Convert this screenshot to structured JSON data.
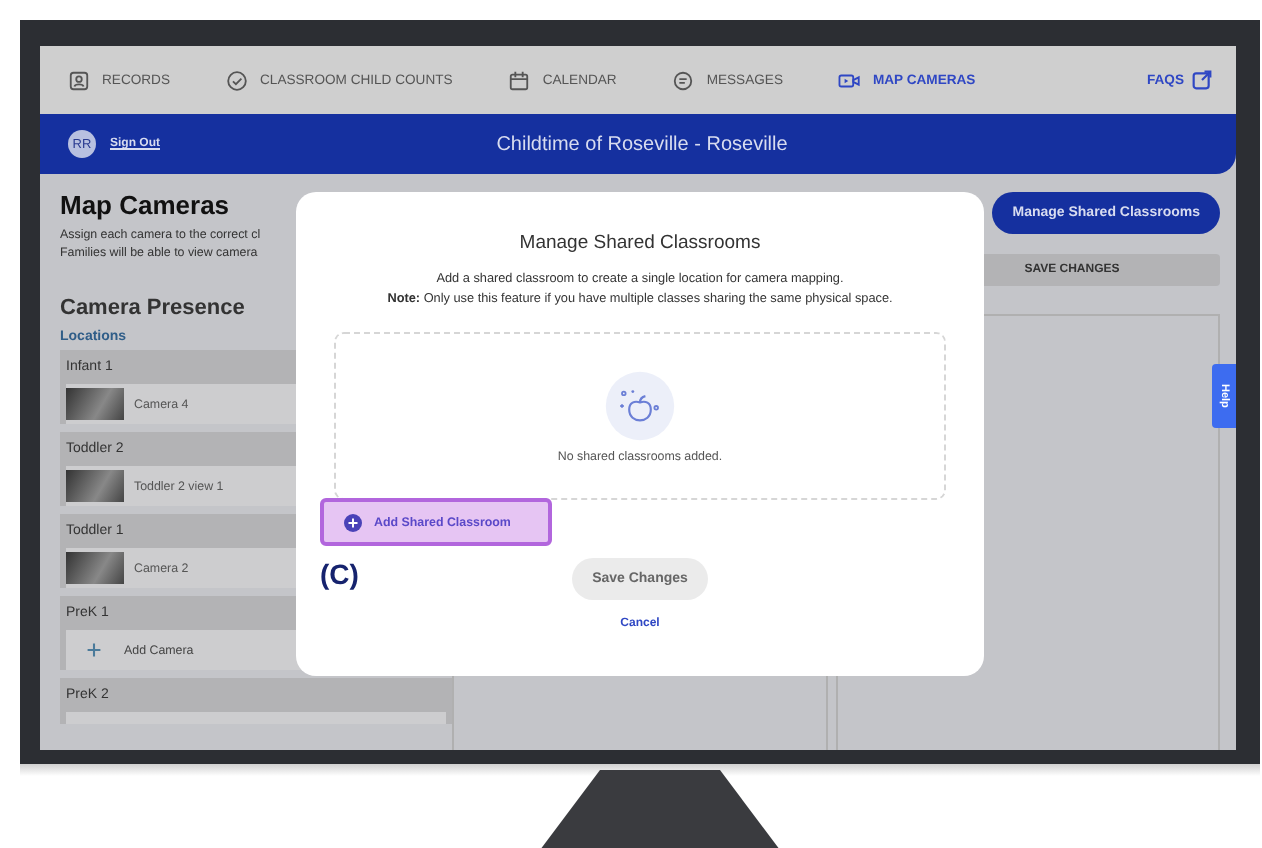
{
  "nav": {
    "items": [
      {
        "label": "RECORDS",
        "kind": "records",
        "selected": false
      },
      {
        "label": "CLASSROOM CHILD COUNTS",
        "kind": "counts",
        "selected": false
      },
      {
        "label": "CALENDAR",
        "kind": "calendar",
        "selected": false
      },
      {
        "label": "MESSAGES",
        "kind": "messages",
        "selected": false
      },
      {
        "label": "MAP CAMERAS",
        "kind": "cameras",
        "selected": true
      }
    ],
    "faqs": "FAQS"
  },
  "header": {
    "avatar": "RR",
    "sign_out": "Sign Out",
    "title": "Childtime of Roseville - Roseville"
  },
  "page": {
    "title": "Map Cameras",
    "description": [
      "Assign each camera to the correct cl",
      "Families will be able to view camera"
    ],
    "manage_button": "Manage Shared Classrooms"
  },
  "camera_presence": {
    "title": "Camera Presence",
    "locations_label": "Locations",
    "locations": [
      {
        "name": "Infant 1",
        "cameras": [
          {
            "kind": "photo",
            "label": "Camera 4"
          }
        ]
      },
      {
        "name": "Toddler 2",
        "cameras": [
          {
            "kind": "photo",
            "label": "Toddler 2 view 1"
          }
        ]
      },
      {
        "name": "Toddler 1",
        "cameras": [
          {
            "kind": "photo",
            "label": "Camera 2"
          }
        ]
      },
      {
        "name": "PreK 1",
        "cameras": [
          {
            "kind": "add",
            "label": "Add Camera"
          }
        ]
      },
      {
        "name": "PreK 2"
      }
    ]
  },
  "save_bar": "SAVE CHANGES",
  "help_tab": "Help",
  "modal": {
    "title": "Manage Shared Classrooms",
    "description": "Add a shared classroom to create a single location for camera mapping.",
    "note": "**Note:** Only use this feature if you have multiple classes sharing the same physical space.",
    "empty_text": "No shared classrooms added.",
    "add_button": {
      "label": "Add Shared Classroom",
      "highlighted": true
    },
    "annotation": "(C)",
    "save_button": {
      "label": "Save Changes",
      "disabled": true
    },
    "cancel": "Cancel"
  }
}
